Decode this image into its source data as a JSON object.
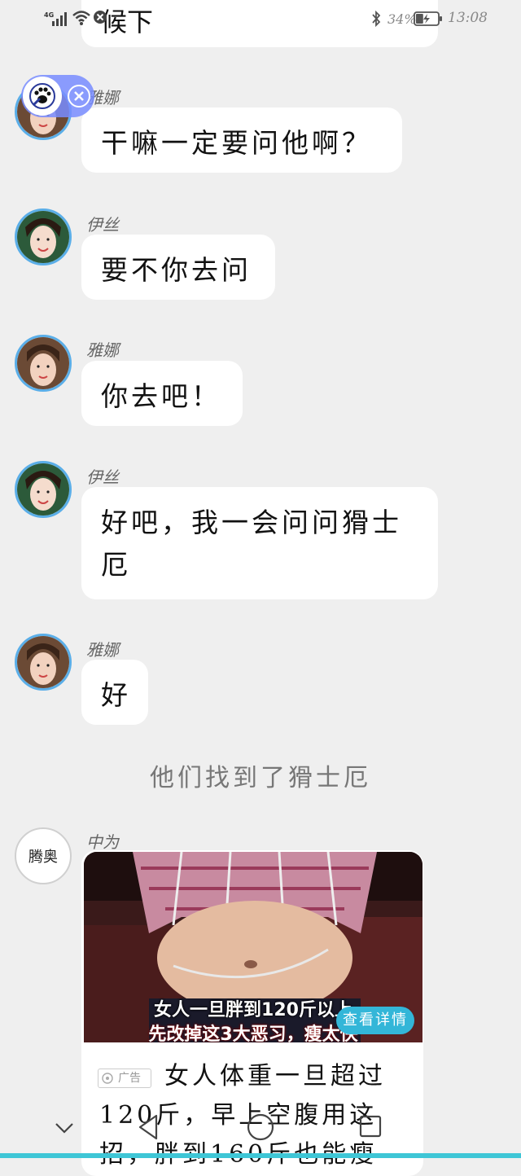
{
  "status_bar": {
    "network": "4G",
    "battery_percent": "34%",
    "time": "13:08",
    "battery_level": 0.34
  },
  "previous_message": {
    "text": "候下"
  },
  "messages": [
    {
      "sender": "雅娜",
      "text": "干嘛一定要问他啊？"
    },
    {
      "sender": "伊丝",
      "text": "要不你去问"
    },
    {
      "sender": "雅娜",
      "text": "你去吧！"
    },
    {
      "sender": "伊丝",
      "text": "好吧，我一会问问猾士厄"
    },
    {
      "sender": "雅娜",
      "text": "好"
    }
  ],
  "system_message": "他们找到了猾士厄",
  "ad": {
    "sender": "中为",
    "avatar_text": "腾奥",
    "image_caption_1": "女人一旦胖到120斤以上",
    "image_caption_2": "先改掉这3大恶习，瘦太快",
    "view_details_label": "查看详情",
    "badge_label": "广告",
    "title": "女人体重一旦超过120斤，早上空腹用这招，胖到160斤也能瘦"
  },
  "nav": {
    "icons": [
      "chevron-down-icon",
      "back-triangle-icon",
      "home-circle-icon",
      "recent-square-icon"
    ]
  },
  "colors": {
    "avatar_ring": "#5aaee8",
    "accent_cyan": "#33b6d8",
    "float_widget": "#7a8cff",
    "background": "#efefef"
  }
}
